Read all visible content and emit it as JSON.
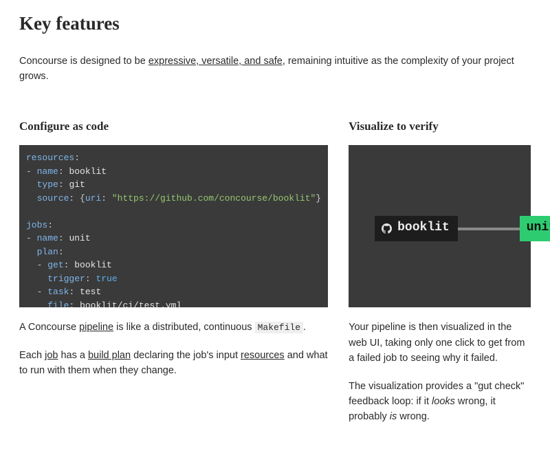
{
  "heading": "Key features",
  "intro": {
    "pre": "Concourse is designed to be ",
    "link": "expressive, versatile, and safe",
    "post": ", remaining intuitive as the complexity of your project grows."
  },
  "left": {
    "title": "Configure as code",
    "code_tokens": [
      {
        "t": "key",
        "v": "resources"
      },
      {
        "t": "punc",
        "v": ":"
      },
      {
        "t": "nl"
      },
      {
        "t": "dash",
        "v": "- "
      },
      {
        "t": "key",
        "v": "name"
      },
      {
        "t": "punc",
        "v": ": "
      },
      {
        "t": "plain",
        "v": "booklit"
      },
      {
        "t": "nl"
      },
      {
        "t": "indent",
        "v": "  "
      },
      {
        "t": "key",
        "v": "type"
      },
      {
        "t": "punc",
        "v": ": "
      },
      {
        "t": "plain",
        "v": "git"
      },
      {
        "t": "nl"
      },
      {
        "t": "indent",
        "v": "  "
      },
      {
        "t": "key",
        "v": "source"
      },
      {
        "t": "punc",
        "v": ": {"
      },
      {
        "t": "key",
        "v": "uri"
      },
      {
        "t": "punc",
        "v": ": "
      },
      {
        "t": "str",
        "v": "\"https://github.com/concourse/booklit\""
      },
      {
        "t": "punc",
        "v": "}"
      },
      {
        "t": "nl"
      },
      {
        "t": "nl"
      },
      {
        "t": "key",
        "v": "jobs"
      },
      {
        "t": "punc",
        "v": ":"
      },
      {
        "t": "nl"
      },
      {
        "t": "dash",
        "v": "- "
      },
      {
        "t": "key",
        "v": "name"
      },
      {
        "t": "punc",
        "v": ": "
      },
      {
        "t": "plain",
        "v": "unit"
      },
      {
        "t": "nl"
      },
      {
        "t": "indent",
        "v": "  "
      },
      {
        "t": "key",
        "v": "plan"
      },
      {
        "t": "punc",
        "v": ":"
      },
      {
        "t": "nl"
      },
      {
        "t": "indent",
        "v": "  "
      },
      {
        "t": "dash",
        "v": "- "
      },
      {
        "t": "key",
        "v": "get"
      },
      {
        "t": "punc",
        "v": ": "
      },
      {
        "t": "plain",
        "v": "booklit"
      },
      {
        "t": "nl"
      },
      {
        "t": "indent",
        "v": "    "
      },
      {
        "t": "key",
        "v": "trigger"
      },
      {
        "t": "punc",
        "v": ": "
      },
      {
        "t": "bool",
        "v": "true"
      },
      {
        "t": "nl"
      },
      {
        "t": "indent",
        "v": "  "
      },
      {
        "t": "dash",
        "v": "- "
      },
      {
        "t": "key",
        "v": "task"
      },
      {
        "t": "punc",
        "v": ": "
      },
      {
        "t": "plain",
        "v": "test"
      },
      {
        "t": "nl"
      },
      {
        "t": "indent",
        "v": "    "
      },
      {
        "t": "key",
        "v": "file"
      },
      {
        "t": "punc",
        "v": ": "
      },
      {
        "t": "plain",
        "v": "booklit/ci/test.yml"
      }
    ],
    "p1_pre": "A Concourse ",
    "p1_link": "pipeline",
    "p1_mid": " is like a distributed, continuous ",
    "p1_code": "Makefile",
    "p1_post": ".",
    "p2_a": "Each ",
    "p2_link1": "job",
    "p2_b": " has a ",
    "p2_link2": "build plan",
    "p2_c": " declaring the job's input ",
    "p2_link3": "resources",
    "p2_d": " and what to run with them when they change."
  },
  "right": {
    "title": "Visualize to verify",
    "resource_label": "booklit",
    "job_label": "unit",
    "p1": "Your pipeline is then visualized in the web UI, taking only one click to get from a failed job to seeing why it failed.",
    "p2_a": "The visualization provides a \"gut check\" feedback loop: if it ",
    "p2_em1": "looks",
    "p2_b": " wrong, it probably ",
    "p2_em2": "is",
    "p2_c": " wrong."
  },
  "icons": {
    "github": "github-icon"
  }
}
